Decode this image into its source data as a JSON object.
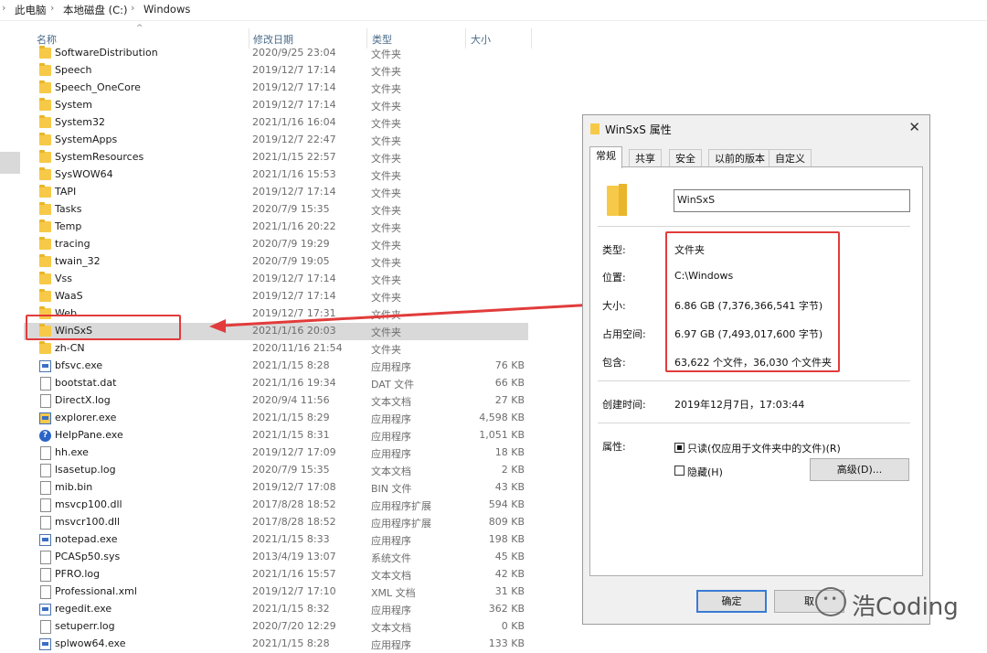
{
  "breadcrumb": [
    "此电脑",
    "本地磁盘 (C:)",
    "Windows"
  ],
  "columns": {
    "name": "名称",
    "date": "修改日期",
    "type": "类型",
    "size": "大小"
  },
  "files": [
    {
      "name": "SoftwareDistribution",
      "date": "2020/9/25 23:04",
      "type": "文件夹",
      "size": "",
      "icon": "folder-icon"
    },
    {
      "name": "Speech",
      "date": "2019/12/7 17:14",
      "type": "文件夹",
      "size": "",
      "icon": "folder-icon"
    },
    {
      "name": "Speech_OneCore",
      "date": "2019/12/7 17:14",
      "type": "文件夹",
      "size": "",
      "icon": "folder-icon"
    },
    {
      "name": "System",
      "date": "2019/12/7 17:14",
      "type": "文件夹",
      "size": "",
      "icon": "folder-icon"
    },
    {
      "name": "System32",
      "date": "2021/1/16 16:04",
      "type": "文件夹",
      "size": "",
      "icon": "folder-icon"
    },
    {
      "name": "SystemApps",
      "date": "2019/12/7 22:47",
      "type": "文件夹",
      "size": "",
      "icon": "folder-icon"
    },
    {
      "name": "SystemResources",
      "date": "2021/1/15 22:57",
      "type": "文件夹",
      "size": "",
      "icon": "folder-icon"
    },
    {
      "name": "SysWOW64",
      "date": "2021/1/16 15:53",
      "type": "文件夹",
      "size": "",
      "icon": "folder-icon"
    },
    {
      "name": "TAPI",
      "date": "2019/12/7 17:14",
      "type": "文件夹",
      "size": "",
      "icon": "folder-icon"
    },
    {
      "name": "Tasks",
      "date": "2020/7/9 15:35",
      "type": "文件夹",
      "size": "",
      "icon": "folder-icon"
    },
    {
      "name": "Temp",
      "date": "2021/1/16 20:22",
      "type": "文件夹",
      "size": "",
      "icon": "folder-icon"
    },
    {
      "name": "tracing",
      "date": "2020/7/9 19:29",
      "type": "文件夹",
      "size": "",
      "icon": "folder-icon"
    },
    {
      "name": "twain_32",
      "date": "2020/7/9 19:05",
      "type": "文件夹",
      "size": "",
      "icon": "folder-icon"
    },
    {
      "name": "Vss",
      "date": "2019/12/7 17:14",
      "type": "文件夹",
      "size": "",
      "icon": "folder-icon"
    },
    {
      "name": "WaaS",
      "date": "2019/12/7 17:14",
      "type": "文件夹",
      "size": "",
      "icon": "folder-icon"
    },
    {
      "name": "Web",
      "date": "2019/12/7 17:31",
      "type": "文件夹",
      "size": "",
      "icon": "folder-icon"
    },
    {
      "name": "WinSxS",
      "date": "2021/1/16 20:03",
      "type": "文件夹",
      "size": "",
      "icon": "folder-icon",
      "selected": true
    },
    {
      "name": "zh-CN",
      "date": "2020/11/16 21:54",
      "type": "文件夹",
      "size": "",
      "icon": "folder-icon"
    },
    {
      "name": "bfsvc.exe",
      "date": "2021/1/15 8:28",
      "type": "应用程序",
      "size": "76 KB",
      "icon": "exe-icon"
    },
    {
      "name": "bootstat.dat",
      "date": "2021/1/16 19:34",
      "type": "DAT 文件",
      "size": "66 KB",
      "icon": "file-icon"
    },
    {
      "name": "DirectX.log",
      "date": "2020/9/4 11:56",
      "type": "文本文档",
      "size": "27 KB",
      "icon": "file-icon"
    },
    {
      "name": "explorer.exe",
      "date": "2021/1/15 8:29",
      "type": "应用程序",
      "size": "4,598 KB",
      "icon": "explorer-icon"
    },
    {
      "name": "HelpPane.exe",
      "date": "2021/1/15 8:31",
      "type": "应用程序",
      "size": "1,051 KB",
      "icon": "help-icon"
    },
    {
      "name": "hh.exe",
      "date": "2019/12/7 17:09",
      "type": "应用程序",
      "size": "18 KB",
      "icon": "help-file-icon"
    },
    {
      "name": "lsasetup.log",
      "date": "2020/7/9 15:35",
      "type": "文本文档",
      "size": "2 KB",
      "icon": "file-icon"
    },
    {
      "name": "mib.bin",
      "date": "2019/12/7 17:08",
      "type": "BIN 文件",
      "size": "43 KB",
      "icon": "file-icon"
    },
    {
      "name": "msvcp100.dll",
      "date": "2017/8/28 18:52",
      "type": "应用程序扩展",
      "size": "594 KB",
      "icon": "dll-icon"
    },
    {
      "name": "msvcr100.dll",
      "date": "2017/8/28 18:52",
      "type": "应用程序扩展",
      "size": "809 KB",
      "icon": "dll-icon"
    },
    {
      "name": "notepad.exe",
      "date": "2021/1/15 8:33",
      "type": "应用程序",
      "size": "198 KB",
      "icon": "exe-icon"
    },
    {
      "name": "PCASp50.sys",
      "date": "2013/4/19 13:07",
      "type": "系统文件",
      "size": "45 KB",
      "icon": "file-icon"
    },
    {
      "name": "PFRO.log",
      "date": "2021/1/16 15:57",
      "type": "文本文档",
      "size": "42 KB",
      "icon": "file-icon"
    },
    {
      "name": "Professional.xml",
      "date": "2019/12/7 17:10",
      "type": "XML 文档",
      "size": "31 KB",
      "icon": "file-icon"
    },
    {
      "name": "regedit.exe",
      "date": "2021/1/15 8:32",
      "type": "应用程序",
      "size": "362 KB",
      "icon": "exe-icon"
    },
    {
      "name": "setuperr.log",
      "date": "2020/7/20 12:29",
      "type": "文本文档",
      "size": "0 KB",
      "icon": "file-icon"
    },
    {
      "name": "splwow64.exe",
      "date": "2021/1/15 8:28",
      "type": "应用程序",
      "size": "133 KB",
      "icon": "exe-icon"
    }
  ],
  "dialog": {
    "title": "WinSxS 属性",
    "close": "✕",
    "tabs": [
      "常规",
      "共享",
      "安全",
      "以前的版本",
      "自定义"
    ],
    "folder_name": "WinSxS",
    "props": [
      {
        "label": "类型:",
        "value": "文件夹"
      },
      {
        "label": "位置:",
        "value": "C:\\Windows"
      },
      {
        "label": "大小:",
        "value": "6.86 GB (7,376,366,541 字节)"
      },
      {
        "label": "占用空间:",
        "value": "6.97 GB (7,493,017,600 字节)"
      },
      {
        "label": "包含:",
        "value": "63,622 个文件，36,030 个文件夹"
      }
    ],
    "created_label": "创建时间:",
    "created_value": "2019年12月7日，17:03:44",
    "attr_label": "属性:",
    "readonly_label": "只读(仅应用于文件夹中的文件)(R)",
    "hidden_label": "隐藏(H)",
    "advanced_button": "高级(D)...",
    "ok_button": "确定",
    "cancel_button": "取"
  },
  "watermark": "浩Coding",
  "colors": {
    "highlight_red": "#e23b3b",
    "selection_gray": "#d9d9d9",
    "folder_yellow": "#f7c948"
  }
}
